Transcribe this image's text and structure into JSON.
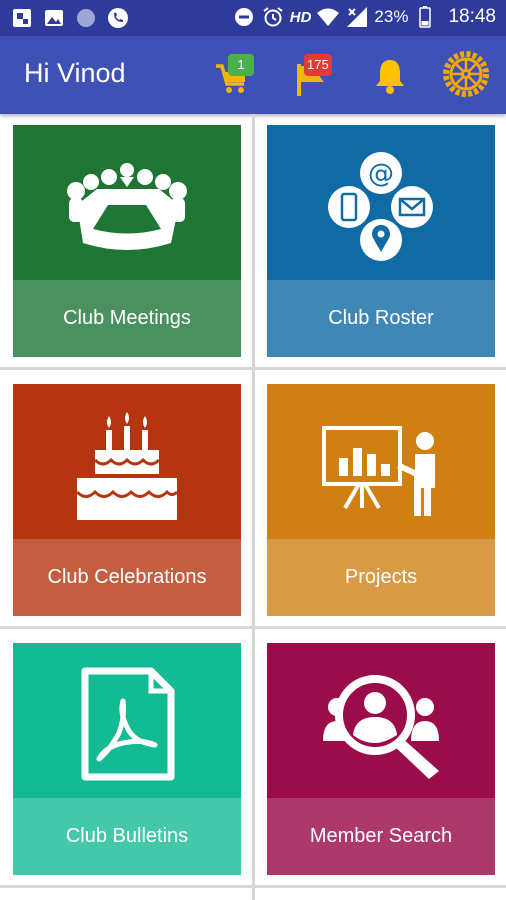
{
  "status_bar": {
    "network": "HD",
    "battery": "23%",
    "time": "18:48"
  },
  "app_bar": {
    "title": "Hi Vinod",
    "cart_badge": "1",
    "flag_badge": "175"
  },
  "tiles": [
    {
      "label": "Club Meetings",
      "icon": "meeting-icon",
      "color": "#1e7534",
      "label_color": "#4b9160"
    },
    {
      "label": "Club Roster",
      "icon": "roster-icon",
      "color": "#106aa3",
      "label_color": "#3f88b6"
    },
    {
      "label": "Club Celebrations",
      "icon": "cake-icon",
      "color": "#b4350f",
      "label_color": "#c35f40"
    },
    {
      "label": "Projects",
      "icon": "presentation-icon",
      "color": "#d07f12",
      "label_color": "#d99a45"
    },
    {
      "label": "Club Bulletins",
      "icon": "pdf-document-icon",
      "color": "#13bb94",
      "label_color": "#43c9aa"
    },
    {
      "label": "Member Search",
      "icon": "member-search-icon",
      "color": "#9b0c4a",
      "label_color": "#ad396b"
    }
  ],
  "colors": {
    "status_bar": "#2e3b9a",
    "app_bar": "#3f51b5",
    "cart_badge": "#4caf50",
    "flag_badge": "#e53935",
    "bell": "#ffc107",
    "rotary_wheel": "#f2a900"
  }
}
